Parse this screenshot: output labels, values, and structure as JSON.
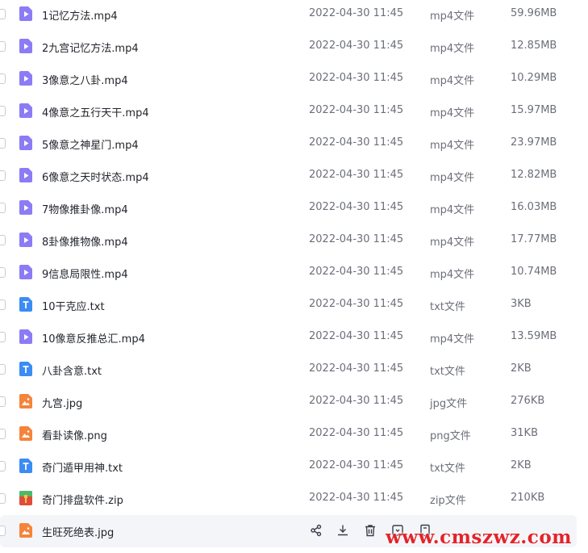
{
  "files": [
    {
      "name": "1记忆方法.mp4",
      "date": "2022-04-30 11:45",
      "type": "mp4文件",
      "size": "59.96MB",
      "icon": "video-file-icon"
    },
    {
      "name": "2九宫记忆方法.mp4",
      "date": "2022-04-30 11:45",
      "type": "mp4文件",
      "size": "12.85MB",
      "icon": "video-file-icon"
    },
    {
      "name": "3像意之八卦.mp4",
      "date": "2022-04-30 11:45",
      "type": "mp4文件",
      "size": "10.29MB",
      "icon": "video-file-icon"
    },
    {
      "name": "4像意之五行天干.mp4",
      "date": "2022-04-30 11:45",
      "type": "mp4文件",
      "size": "15.97MB",
      "icon": "video-file-icon"
    },
    {
      "name": "5像意之神星门.mp4",
      "date": "2022-04-30 11:45",
      "type": "mp4文件",
      "size": "23.97MB",
      "icon": "video-file-icon"
    },
    {
      "name": "6像意之天时状态.mp4",
      "date": "2022-04-30 11:45",
      "type": "mp4文件",
      "size": "12.82MB",
      "icon": "video-file-icon"
    },
    {
      "name": "7物像推卦像.mp4",
      "date": "2022-04-30 11:45",
      "type": "mp4文件",
      "size": "16.03MB",
      "icon": "video-file-icon"
    },
    {
      "name": "8卦像推物像.mp4",
      "date": "2022-04-30 11:45",
      "type": "mp4文件",
      "size": "17.77MB",
      "icon": "video-file-icon"
    },
    {
      "name": "9信息局限性.mp4",
      "date": "2022-04-30 11:45",
      "type": "mp4文件",
      "size": "10.74MB",
      "icon": "video-file-icon"
    },
    {
      "name": "10干克应.txt",
      "date": "2022-04-30 11:45",
      "type": "txt文件",
      "size": "3KB",
      "icon": "text-file-icon"
    },
    {
      "name": "10像意反推总汇.mp4",
      "date": "2022-04-30 11:45",
      "type": "mp4文件",
      "size": "13.59MB",
      "icon": "video-file-icon"
    },
    {
      "name": "八卦含意.txt",
      "date": "2022-04-30 11:45",
      "type": "txt文件",
      "size": "2KB",
      "icon": "text-file-icon"
    },
    {
      "name": "九宫.jpg",
      "date": "2022-04-30 11:45",
      "type": "jpg文件",
      "size": "276KB",
      "icon": "image-file-icon"
    },
    {
      "name": "看卦读像.png",
      "date": "2022-04-30 11:45",
      "type": "png文件",
      "size": "31KB",
      "icon": "image-file-icon"
    },
    {
      "name": "奇门遁甲用神.txt",
      "date": "2022-04-30 11:45",
      "type": "txt文件",
      "size": "2KB",
      "icon": "text-file-icon"
    },
    {
      "name": "奇门排盘软件.zip",
      "date": "2022-04-30 11:45",
      "type": "zip文件",
      "size": "210KB",
      "icon": "zip-file-icon"
    }
  ],
  "hover_row": {
    "name": "生旺死绝表.jpg",
    "icon": "image-file-icon",
    "actions": [
      "share-icon",
      "download-icon",
      "delete-icon",
      "move-icon",
      "more-icon"
    ]
  },
  "watermark": "www.cmszwz.com",
  "colors": {
    "video": "#8b7cf6",
    "text": "#3b8cf5",
    "image": "#f5843b",
    "zip_top": "#4fb86b",
    "zip_bottom": "#e24a3b",
    "watermark": "#e3242b"
  }
}
